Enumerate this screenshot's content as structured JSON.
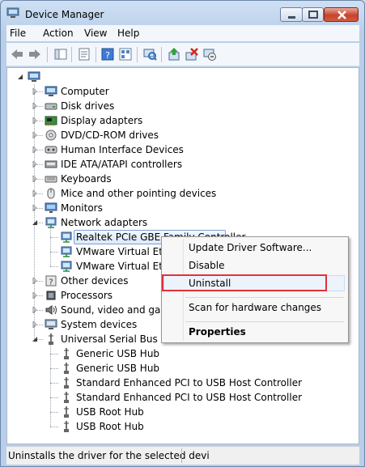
{
  "window": {
    "title": "Device Manager"
  },
  "menu": [
    "File",
    "Action",
    "View",
    "Help"
  ],
  "tree": {
    "root_label": "",
    "categories": [
      {
        "label": "Computer",
        "icon": "computer-icon"
      },
      {
        "label": "Disk drives",
        "icon": "disk-drive-icon"
      },
      {
        "label": "Display adapters",
        "icon": "display-adapter-icon"
      },
      {
        "label": "DVD/CD-ROM drives",
        "icon": "dvd-drive-icon"
      },
      {
        "label": "Human Interface Devices",
        "icon": "hid-icon"
      },
      {
        "label": "IDE ATA/ATAPI controllers",
        "icon": "ide-controller-icon"
      },
      {
        "label": "Keyboards",
        "icon": "keyboard-icon"
      },
      {
        "label": "Mice and other pointing devices",
        "icon": "mouse-icon"
      },
      {
        "label": "Monitors",
        "icon": "monitor-icon"
      },
      {
        "label": "Network adapters",
        "icon": "network-adapter-icon"
      },
      {
        "label": "Realtek PCIe GBE Family Controller",
        "icon": "network-adapter-icon"
      },
      {
        "label": "VMware Virtual Ethe",
        "icon": "network-adapter-icon"
      },
      {
        "label": "VMware Virtual Ethe",
        "icon": "network-adapter-icon"
      },
      {
        "label": "Other devices",
        "icon": "unknown-device-icon"
      },
      {
        "label": "Processors",
        "icon": "processor-icon"
      },
      {
        "label": "Sound, video and game",
        "icon": "sound-icon"
      },
      {
        "label": "System devices",
        "icon": "system-device-icon"
      },
      {
        "label": "Universal Serial Bus cont",
        "icon": "usb-icon"
      },
      {
        "label": "Generic USB Hub",
        "icon": "usb-icon"
      },
      {
        "label": "Generic USB Hub",
        "icon": "usb-icon"
      },
      {
        "label": "Standard Enhanced PCI to USB Host Controller",
        "icon": "usb-icon"
      },
      {
        "label": "Standard Enhanced PCI to USB Host Controller",
        "icon": "usb-icon"
      },
      {
        "label": "USB Root Hub",
        "icon": "usb-icon"
      },
      {
        "label": "USB Root Hub",
        "icon": "usb-icon"
      }
    ]
  },
  "context_menu": {
    "items": [
      "Update Driver Software...",
      "Disable",
      "Uninstall",
      "Scan for hardware changes",
      "Properties"
    ]
  },
  "status": {
    "text": "Uninstalls the driver for the selected devi"
  },
  "colors": {
    "highlight_border": "#e0323a",
    "selection_bg": "#dce9fb"
  }
}
